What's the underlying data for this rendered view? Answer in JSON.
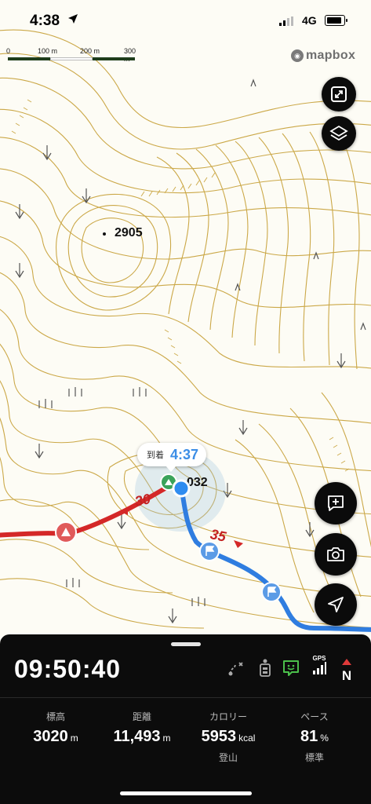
{
  "status_bar": {
    "time": "4:38",
    "network": "4G"
  },
  "map": {
    "scale_labels": [
      "0",
      "100 m",
      "200 m",
      "300 m"
    ],
    "attribution": "mapbox",
    "summit_label": "2905",
    "peak_label": "3032",
    "peak_label_visible": "032",
    "segment_times": [
      "30",
      "35"
    ],
    "arrival_label": "到着",
    "arrival_time": "4:37",
    "colors": {
      "contour": "#c9a43f",
      "route_walked": "#d42828",
      "route_planned": "#2f7de0",
      "current_position": "#2f8cf0"
    }
  },
  "controls": {
    "icons": [
      "expand-icon",
      "layers-icon",
      "add-note-icon",
      "camera-icon",
      "navigate-icon"
    ]
  },
  "panel": {
    "elapsed": "09:50:40",
    "status_icons": [
      "route-icon",
      "battery-icon",
      "message-icon",
      "gps-signal-icon",
      "compass-icon"
    ],
    "gps_label": "GPS",
    "compass_label": "N",
    "stats": [
      {
        "label": "標高",
        "value": "3020",
        "unit": "m",
        "sub": ""
      },
      {
        "label": "距離",
        "value": "11,493",
        "unit": "m",
        "sub": ""
      },
      {
        "label": "カロリー",
        "value": "5953",
        "unit": "kcal",
        "sub": "登山"
      },
      {
        "label": "ペース",
        "value": "81",
        "unit": "%",
        "sub": "標準"
      }
    ]
  }
}
